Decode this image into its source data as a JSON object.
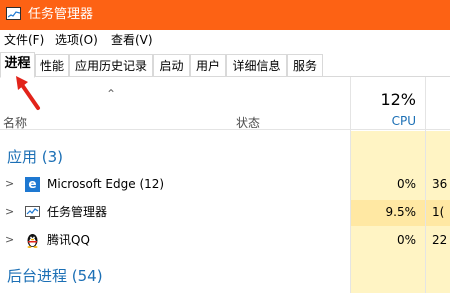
{
  "window": {
    "title": "任务管理器"
  },
  "menu": {
    "file": "文件(F)",
    "options": "选项(O)",
    "view": "查看(V)"
  },
  "tabs": [
    "进程",
    "性能",
    "应用历史记录",
    "启动",
    "用户",
    "详细信息",
    "服务"
  ],
  "columns": {
    "name": "名称",
    "status": "状态",
    "cpu_percent": "12%",
    "cpu_label": "CPU"
  },
  "groups": {
    "apps": "应用 (3)",
    "background": "后台进程 (54)"
  },
  "processes": [
    {
      "name": "Microsoft Edge (12)",
      "icon": "edge-icon",
      "cpu": "0%",
      "mem_partial": "36"
    },
    {
      "name": "任务管理器",
      "icon": "task-manager-icon",
      "cpu": "9.5%",
      "mem_partial": "1("
    },
    {
      "name": "腾讯QQ",
      "icon": "qq-penguin-icon",
      "cpu": "0%",
      "mem_partial": "22"
    }
  ],
  "colors": {
    "titlebar": "#fd6214",
    "accent_blue": "#1b6fb5",
    "heat_light": "#fff4c4",
    "heat_medium": "#ffe8a3",
    "annotation_arrow": "#e2231a"
  }
}
